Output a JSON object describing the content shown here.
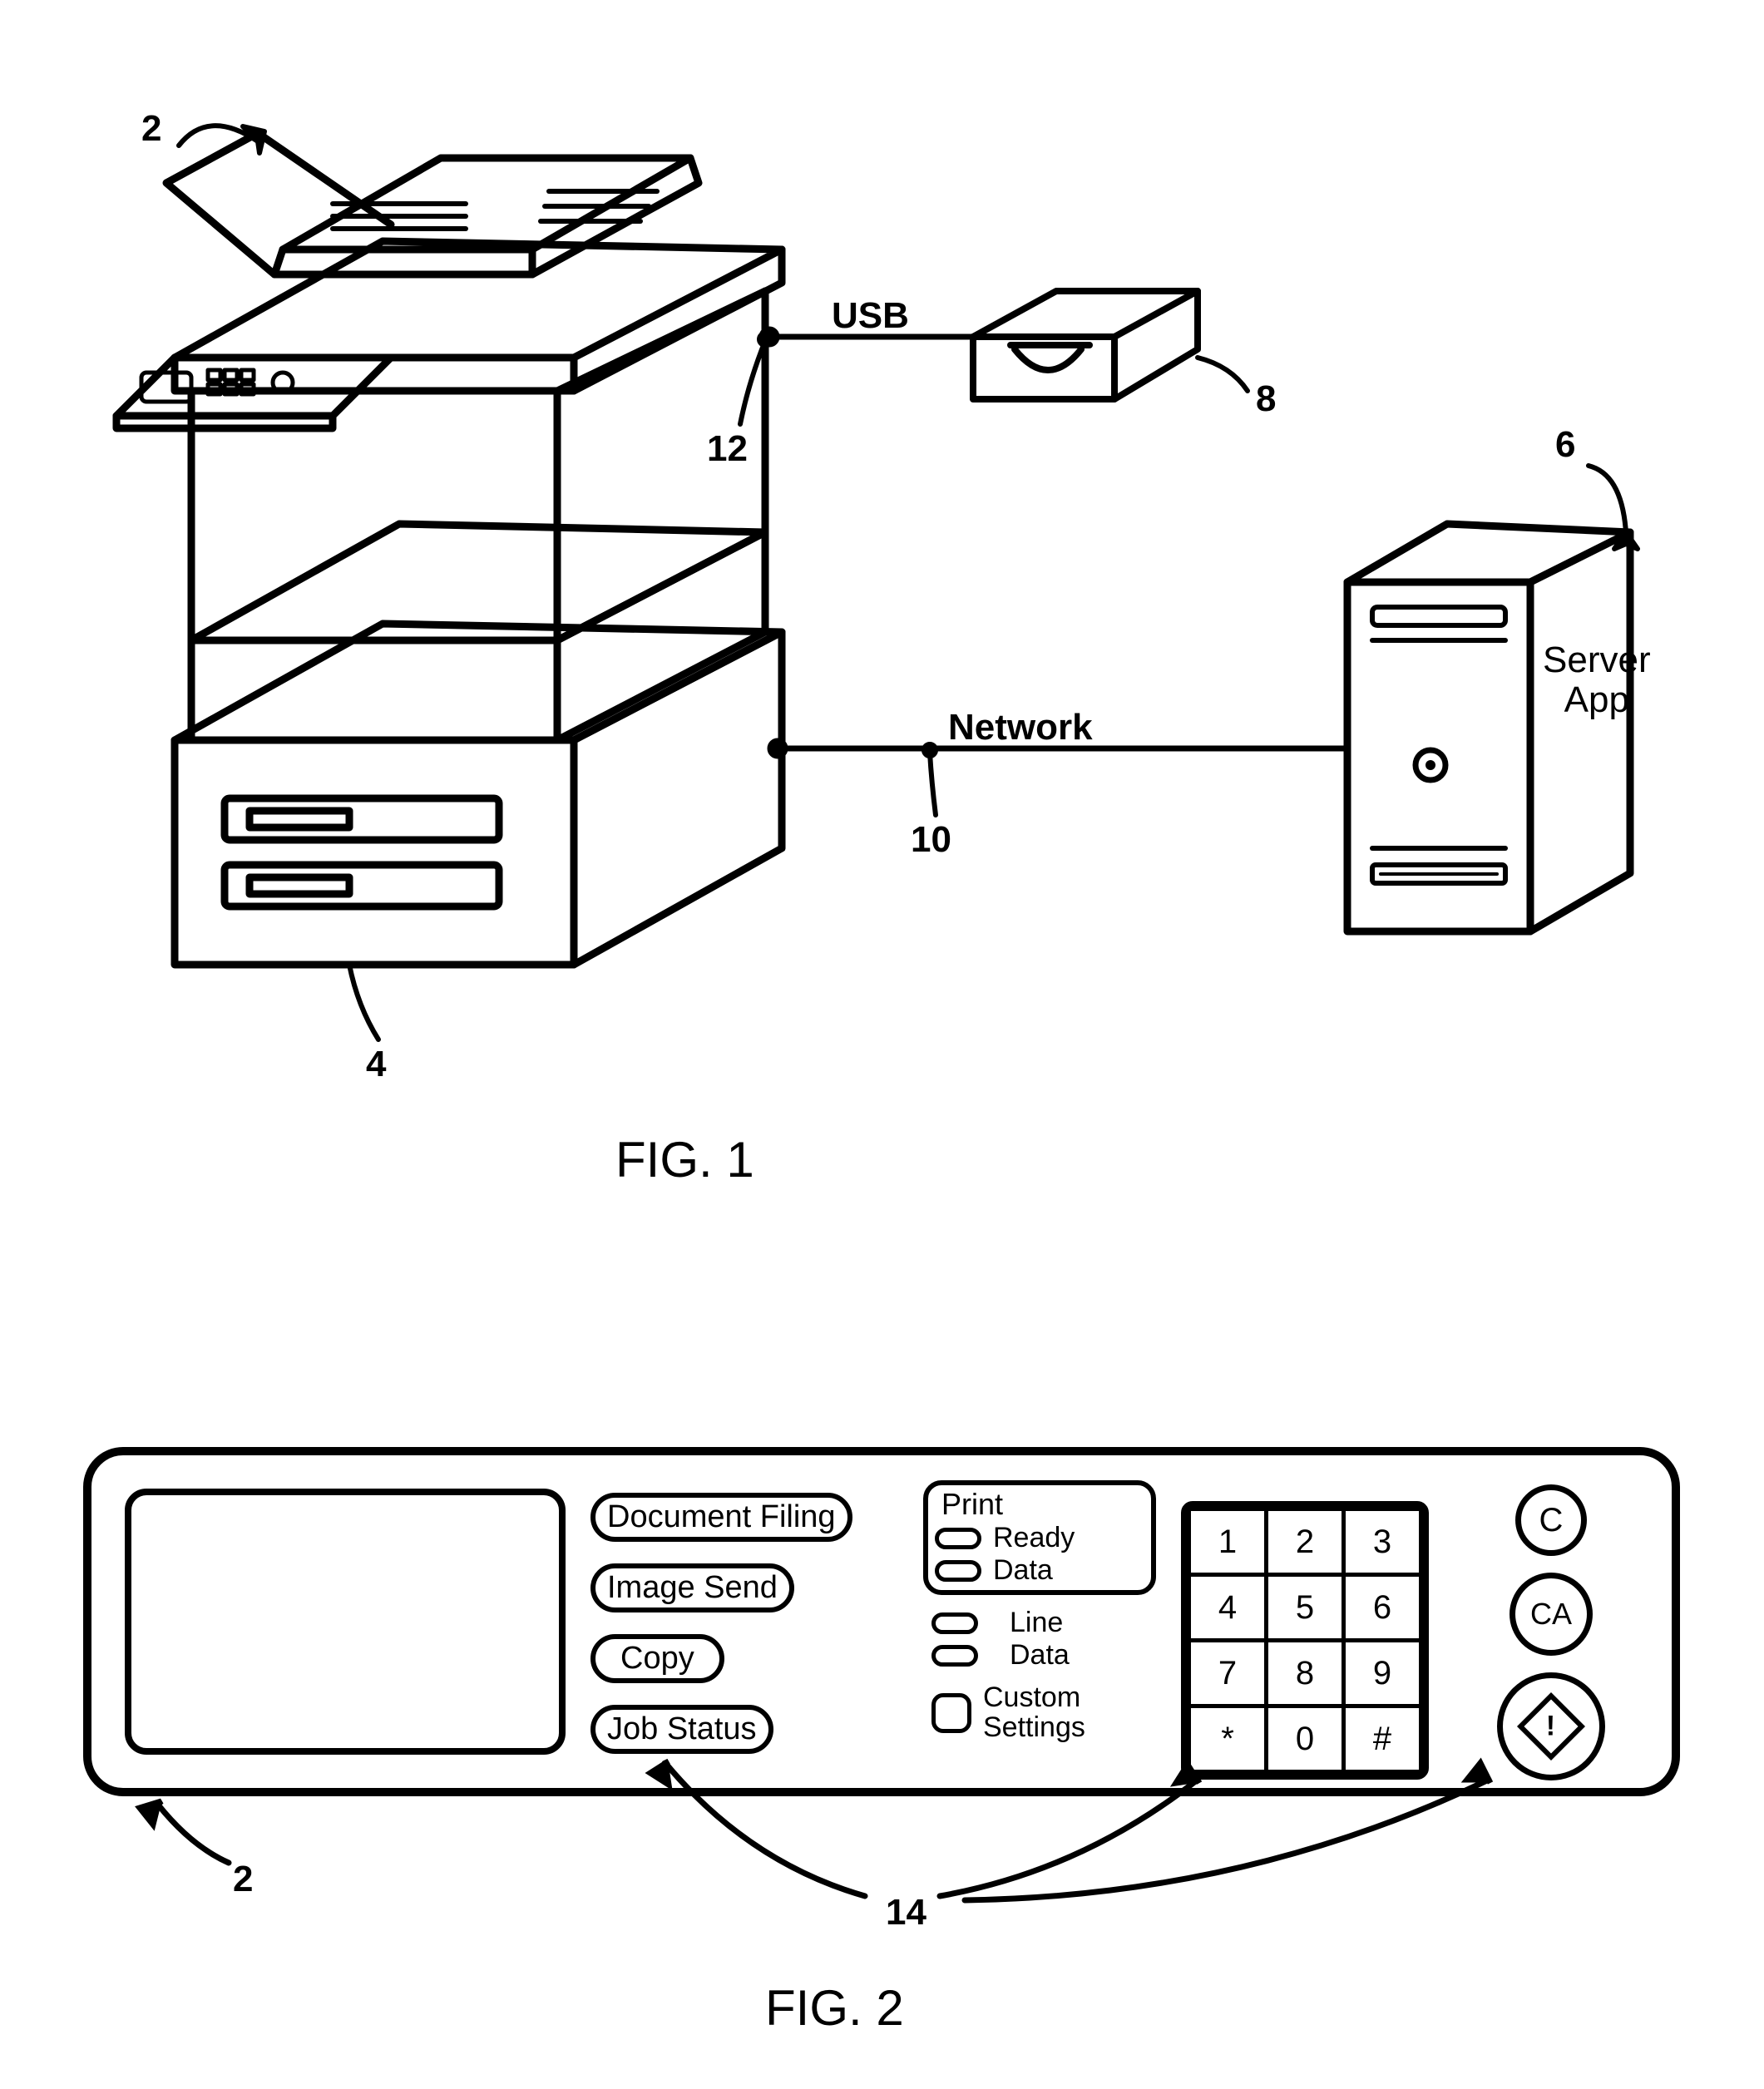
{
  "fig1": {
    "title": "FIG. 1",
    "labels": {
      "usb": "USB",
      "network": "Network",
      "server1": "Server",
      "server2": "App"
    },
    "callouts": {
      "mfp_top": "2",
      "mfp_base": "4",
      "server": "6",
      "card_reader": "8",
      "net_line": "10",
      "usb_line": "12"
    }
  },
  "fig2": {
    "title": "FIG. 2",
    "callouts": {
      "panel": "2",
      "buttons_group": "14"
    },
    "func_buttons": {
      "doc_filing": "Document Filing",
      "image_send": "Image Send",
      "copy": "Copy",
      "job_status": "Job Status"
    },
    "status": {
      "print": {
        "title": "Print",
        "ready": "Ready",
        "data": "Data"
      },
      "line": {
        "line": "Line",
        "data": "Data"
      },
      "custom": {
        "l1": "Custom",
        "l2": "Settings"
      }
    },
    "keypad": {
      "k1": "1",
      "k2": "2",
      "k3": "3",
      "k4": "4",
      "k5": "5",
      "k6": "6",
      "k7": "7",
      "k8": "8",
      "k9": "9",
      "kS": "*",
      "k0": "0",
      "kH": "#"
    },
    "round": {
      "c": "C",
      "ca": "CA",
      "start": "!"
    }
  }
}
